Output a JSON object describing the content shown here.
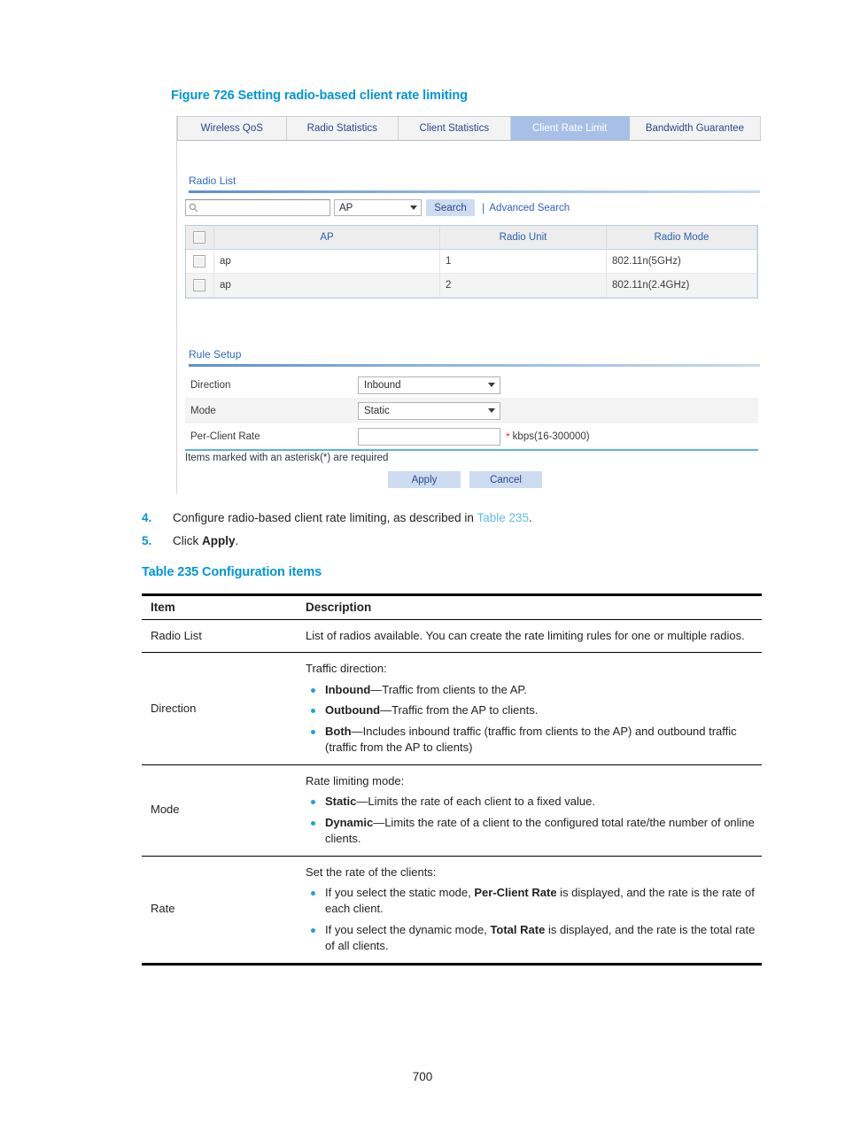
{
  "figure": {
    "caption": "Figure 726 Setting radio-based client rate limiting"
  },
  "screenshot": {
    "tabs": [
      {
        "label": "Wireless QoS",
        "active": false
      },
      {
        "label": "Radio Statistics",
        "active": false
      },
      {
        "label": "Client Statistics",
        "active": false
      },
      {
        "label": "Client Rate Limit",
        "active": true
      },
      {
        "label": "Bandwidth Guarantee",
        "active": false
      }
    ],
    "radio_list": {
      "section_label": "Radio List",
      "search": {
        "input_value": "",
        "input_placeholder": "",
        "field_select": "AP",
        "search_button": "Search",
        "separator": "|",
        "advanced_link": "Advanced Search"
      },
      "table": {
        "columns": [
          "",
          "AP",
          "Radio Unit",
          "Radio Mode"
        ],
        "rows": [
          {
            "ap": "ap",
            "unit": "1",
            "mode": "802.11n(5GHz)"
          },
          {
            "ap": "ap",
            "unit": "2",
            "mode": "802.11n(2.4GHz)"
          }
        ]
      }
    },
    "rule_setup": {
      "section_label": "Rule Setup",
      "fields": [
        {
          "label": "Direction",
          "type": "select",
          "value": "Inbound",
          "required": false,
          "hint": ""
        },
        {
          "label": "Mode",
          "type": "select",
          "value": "Static",
          "required": false,
          "hint": ""
        },
        {
          "label": "Per-Client Rate",
          "type": "text",
          "value": "",
          "required": true,
          "star": "*",
          "hint": "kbps(16-300000)"
        }
      ],
      "asterisk_note": "Items marked with an asterisk(*) are required",
      "buttons": {
        "apply": "Apply",
        "cancel": "Cancel"
      }
    }
  },
  "steps": [
    {
      "num": "4.",
      "parts": [
        {
          "t": "Configure radio-based client rate limiting, as described in ",
          "style": "normal"
        },
        {
          "t": "Table 235",
          "style": "xref"
        },
        {
          "t": ".",
          "style": "normal"
        }
      ]
    },
    {
      "num": "5.",
      "parts": [
        {
          "t": "Click ",
          "style": "normal"
        },
        {
          "t": "Apply",
          "style": "bold"
        },
        {
          "t": ".",
          "style": "normal"
        }
      ]
    }
  ],
  "table235": {
    "caption": "Table 235 Configuration items",
    "headers": {
      "item": "Item",
      "description": "Description"
    },
    "rows": [
      {
        "item": "Radio List",
        "intro": "List of radios available. You can create the rate limiting rules for one or multiple radios.",
        "bullets": []
      },
      {
        "item": "Direction",
        "intro": "Traffic direction:",
        "bullets": [
          {
            "term": "Inbound",
            "rest": "—Traffic from clients to the AP."
          },
          {
            "term": "Outbound",
            "rest": "—Traffic from the AP to clients."
          },
          {
            "term": "Both",
            "rest": "—Includes inbound traffic (traffic from clients to the AP) and outbound traffic (traffic from the AP to clients)"
          }
        ]
      },
      {
        "item": "Mode",
        "intro": "Rate limiting mode:",
        "bullets": [
          {
            "term": "Static",
            "rest": "—Limits the rate of each client to a fixed value."
          },
          {
            "term": "Dynamic",
            "rest": "—Limits the rate of a client to the configured total rate/the number of online clients."
          }
        ]
      },
      {
        "item": "Rate",
        "intro": "Set the rate of the clients:",
        "bullets": [
          {
            "pre": "If you select the static mode, ",
            "term": "Per-Client Rate",
            "rest": " is displayed, and the rate is the rate of each client."
          },
          {
            "pre": "If you select the dynamic mode, ",
            "term": "Total Rate",
            "rest": " is displayed, and the rate is the total rate of all clients."
          }
        ]
      }
    ]
  },
  "page_number": "700",
  "colors": {
    "heading_blue": "#0096d6",
    "xref_blue": "#5fbfe8",
    "bullet_blue": "#1fa0d8",
    "tab_active_bg": "#a8c0e8",
    "ui_link_blue": "#2f5fc0",
    "section_blue": "#2e6bbd",
    "required_red": "#e02b2b"
  }
}
